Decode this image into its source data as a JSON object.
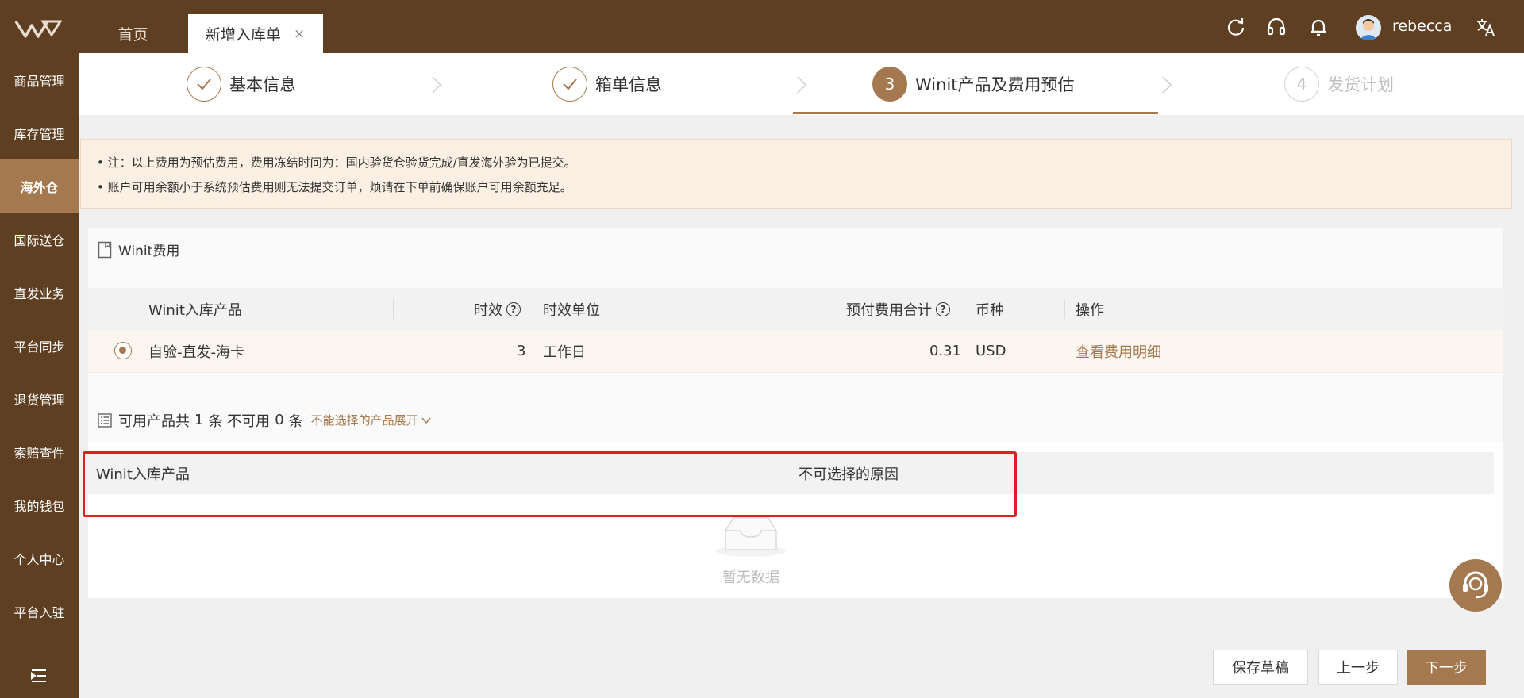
{
  "header": {
    "tabs": [
      {
        "label": "首页"
      },
      {
        "label": "新增入库单",
        "close": "×"
      }
    ],
    "icons": [
      "refresh-icon",
      "headset-icon",
      "bell-icon",
      "translate-icon"
    ],
    "user": {
      "name": "rebecca"
    },
    "colors": {
      "bar": "#5e3f22",
      "accent": "#a5794f"
    }
  },
  "sidebar": {
    "items": [
      {
        "label": "商品管理"
      },
      {
        "label": "库存管理"
      },
      {
        "label": "海外仓",
        "active": true
      },
      {
        "label": "国际送仓"
      },
      {
        "label": "直发业务"
      },
      {
        "label": "平台同步"
      },
      {
        "label": "退货管理"
      },
      {
        "label": "索赔查件"
      },
      {
        "label": "我的钱包"
      },
      {
        "label": "个人中心"
      },
      {
        "label": "平台入驻"
      }
    ]
  },
  "steps": [
    {
      "label": "基本信息",
      "status": "done"
    },
    {
      "label": "箱单信息",
      "status": "done"
    },
    {
      "label": "Winit产品及费用预估",
      "status": "current",
      "number": "3"
    },
    {
      "label": "发货计划",
      "status": "pending",
      "number": "4"
    }
  ],
  "notice": {
    "lines": [
      "• 注：以上费用为预估费用，费用冻结时间为：国内验货仓验货完成/直发海外验为已提交。",
      "• 账户可用余额小于系统预估费用则无法提交订单，烦请在下单前确保账户可用余额充足。"
    ]
  },
  "fee": {
    "title": "Winit费用",
    "columns": {
      "product": "Winit入库产品",
      "timeliness": "时效",
      "unit": "时效单位",
      "total": "预付费用合计",
      "currency": "币种",
      "action": "操作"
    },
    "row": {
      "product": "自验-直发-海卡",
      "timeliness": "3",
      "unit": "工作日",
      "total": "0.31",
      "currency": "USD",
      "action": "查看费用明细"
    }
  },
  "availability": {
    "prefix": "可用产品共",
    "available_count": "1",
    "mid": "条 不可用",
    "unavailable_count": "0",
    "suffix": "条",
    "expand_link": "不能选择的产品展开",
    "columns": {
      "product": "Winit入库产品",
      "reason": "不可选择的原因"
    },
    "empty_text": "暂无数据"
  },
  "buttons": {
    "save_draft": "保存草稿",
    "prev": "上一步",
    "next": "下一步"
  }
}
